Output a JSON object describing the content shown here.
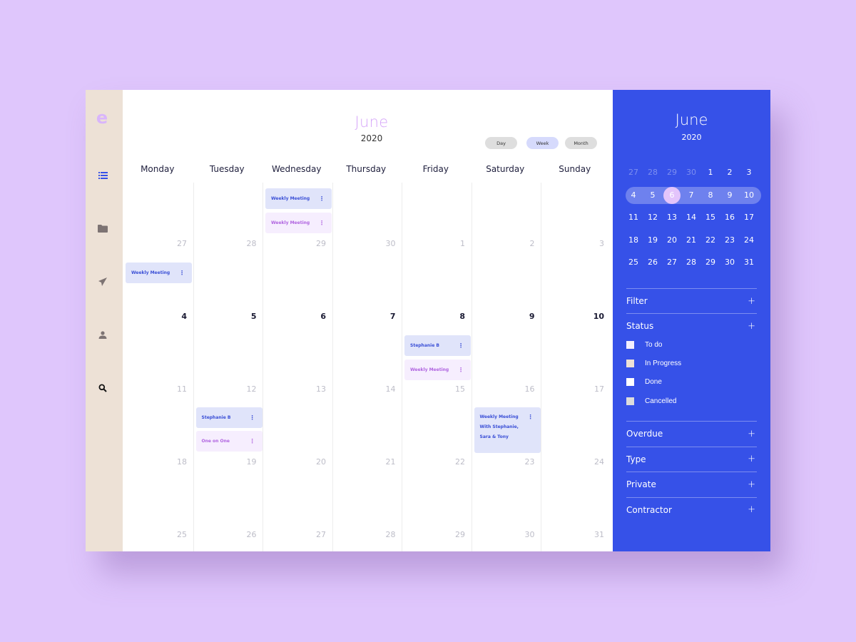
{
  "app": {
    "logo_letter": "e"
  },
  "rail": {
    "icons": [
      {
        "name": "list-icon",
        "color": "#3651e8"
      },
      {
        "name": "folder-icon",
        "color": "#7d7373"
      },
      {
        "name": "send-icon",
        "color": "#7d7373"
      },
      {
        "name": "user-icon",
        "color": "#7d7373"
      },
      {
        "name": "search-icon",
        "color": "#111111"
      }
    ]
  },
  "header": {
    "month": "June",
    "year": "2020",
    "views": [
      {
        "label": "Day",
        "active": false
      },
      {
        "label": "Week",
        "active": true
      },
      {
        "label": "Month",
        "active": false
      }
    ]
  },
  "calendar": {
    "weekdays": [
      "Monday",
      "Tuesday",
      "Wednesday",
      "Thursday",
      "Friday",
      "Saturday",
      "Sunday"
    ],
    "weeks": [
      {
        "days": [
          "27",
          "28",
          "29",
          "30",
          "1",
          "2",
          "3"
        ],
        "current": false
      },
      {
        "days": [
          "4",
          "5",
          "6",
          "7",
          "8",
          "9",
          "10"
        ],
        "current": true
      },
      {
        "days": [
          "11",
          "12",
          "13",
          "14",
          "15",
          "16",
          "17"
        ],
        "current": false
      },
      {
        "days": [
          "18",
          "19",
          "20",
          "21",
          "22",
          "23",
          "24"
        ],
        "current": false
      },
      {
        "days": [
          "25",
          "26",
          "27",
          "28",
          "29",
          "30",
          "31"
        ],
        "current": false
      }
    ],
    "events": [
      {
        "col": 2,
        "slot": "w0-top-a",
        "title": "Weekly Meeting",
        "style": "blue"
      },
      {
        "col": 2,
        "slot": "w0-top-b",
        "title": "Weekly Meeting",
        "style": "pink"
      },
      {
        "col": 0,
        "slot": "w1-top-a",
        "title": "Weekly Meeting",
        "style": "blue"
      },
      {
        "col": 4,
        "slot": "w2-top-a",
        "title": "Stephanie B",
        "style": "blue"
      },
      {
        "col": 4,
        "slot": "w2-top-b",
        "title": "Weekly Meeting",
        "style": "pink"
      },
      {
        "col": 1,
        "slot": "w3-top-a",
        "title": "Stephanie B",
        "style": "blue"
      },
      {
        "col": 1,
        "slot": "w3-top-b",
        "title": "One on One",
        "style": "pink"
      },
      {
        "col": 5,
        "slot": "w3-tall",
        "title": "Weekly Meeting With Stephanie, Sara & Tony",
        "title_lines": [
          "Weekly Meeting",
          "With Stephanie,",
          "Sara & Tony"
        ],
        "style": "blue"
      }
    ],
    "event_menu_glyph": "⋮"
  },
  "side": {
    "month": "June",
    "year": "2020",
    "mini_weeks": [
      [
        {
          "d": "27",
          "m": true
        },
        {
          "d": "28",
          "m": true
        },
        {
          "d": "29",
          "m": true
        },
        {
          "d": "30",
          "m": true
        },
        {
          "d": "1"
        },
        {
          "d": "2"
        },
        {
          "d": "3"
        }
      ],
      [
        {
          "d": "4"
        },
        {
          "d": "5"
        },
        {
          "d": "6",
          "sel": true
        },
        {
          "d": "7"
        },
        {
          "d": "8"
        },
        {
          "d": "9"
        },
        {
          "d": "10"
        }
      ],
      [
        {
          "d": "11"
        },
        {
          "d": "12"
        },
        {
          "d": "13"
        },
        {
          "d": "14"
        },
        {
          "d": "15"
        },
        {
          "d": "16"
        },
        {
          "d": "17"
        }
      ],
      [
        {
          "d": "18"
        },
        {
          "d": "19"
        },
        {
          "d": "20"
        },
        {
          "d": "21"
        },
        {
          "d": "22"
        },
        {
          "d": "23"
        },
        {
          "d": "24"
        }
      ],
      [
        {
          "d": "25"
        },
        {
          "d": "26"
        },
        {
          "d": "27"
        },
        {
          "d": "28"
        },
        {
          "d": "29"
        },
        {
          "d": "30"
        },
        {
          "d": "31"
        }
      ]
    ],
    "highlight_week": 1,
    "filters": {
      "filter_label": "Filter",
      "status_label": "Status",
      "status_items": [
        {
          "label": "To do",
          "color": "#f3eefe"
        },
        {
          "label": "In Progress",
          "color": "#ede1d6"
        },
        {
          "label": "Done",
          "color": "#ffffff"
        },
        {
          "label": "Cancelled",
          "color": "#dcdcdc"
        }
      ],
      "sections": [
        "Overdue",
        "Type",
        "Private",
        "Contractor"
      ],
      "plus_glyph": "+"
    }
  },
  "colors": {
    "page_bg": "#dfc6fc",
    "accent_blue": "#3651e8",
    "rail_bg": "#ede1d6",
    "selected_day": "#e3c4fb"
  }
}
